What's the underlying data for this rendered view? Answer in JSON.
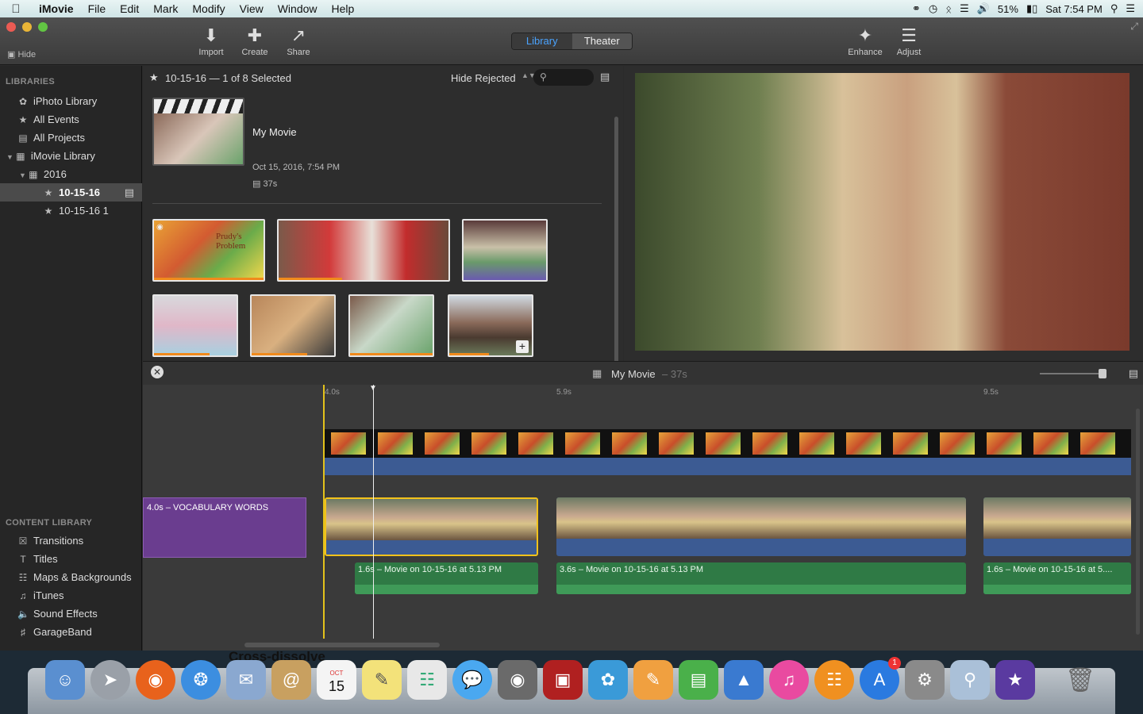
{
  "menubar": {
    "app": "iMovie",
    "items": [
      "File",
      "Edit",
      "Mark",
      "Modify",
      "View",
      "Window",
      "Help"
    ],
    "battery": "51%",
    "clock": "Sat 7:54 PM"
  },
  "toolbar": {
    "hide_label": "Hide",
    "import_label": "Import",
    "create_label": "Create",
    "share_label": "Share",
    "library_tab": "Library",
    "theater_tab": "Theater",
    "enhance_label": "Enhance",
    "adjust_label": "Adjust"
  },
  "sidebar": {
    "libraries_header": "LIBRARIES",
    "items": [
      {
        "label": "iPhoto Library",
        "icon": "iphoto-icon"
      },
      {
        "label": "All Events",
        "icon": "star-icon"
      },
      {
        "label": "All Projects",
        "icon": "clapper-icon"
      },
      {
        "label": "iMovie Library",
        "icon": "grid-icon"
      },
      {
        "label": "2016",
        "icon": "calendar-icon"
      },
      {
        "label": "10-15-16",
        "icon": "star-icon"
      },
      {
        "label": "10-15-16 1",
        "icon": "star-icon"
      }
    ],
    "content_header": "CONTENT LIBRARY",
    "content_items": [
      "Transitions",
      "Titles",
      "Maps & Backgrounds",
      "iTunes",
      "Sound Effects",
      "GarageBand"
    ]
  },
  "browser": {
    "header": "10-15-16 — 1 of 8 Selected",
    "filter": "Hide Rejected",
    "project_title": "My Movie",
    "project_date": "Oct 15, 2016, 7:54 PM",
    "project_duration": "37s",
    "thumb_text_prudy": "Prudy's Problem"
  },
  "timeline_bar": {
    "title": "My Movie",
    "duration": "– 37s"
  },
  "timeline": {
    "ruler": [
      "4.0s",
      "5.9s",
      "9.5s"
    ],
    "title_clip": "4.0s – VOCABULARY  WORDS",
    "audio_clips": [
      "1.6s – Movie on 10-15-16 at 5.13 PM",
      "3.6s – Movie on 10-15-16 at 5.13 PM",
      "1.6s – Movie on 10-15-16 at 5...."
    ]
  },
  "dock": {
    "tooltip": "Cross-dissolve",
    "calendar_month": "OCT",
    "calendar_day": "15",
    "appstore_badge": "1"
  }
}
